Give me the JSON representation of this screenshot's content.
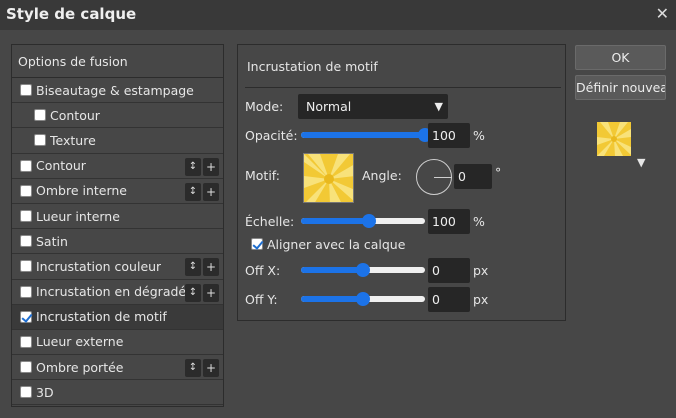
{
  "window": {
    "title": "Style de calque",
    "close_glyph": "✕"
  },
  "left_panel": {
    "header": "Options de fusion",
    "items": [
      {
        "label": "Biseautage & estampage",
        "checked": false,
        "sub": false,
        "buttons": false
      },
      {
        "label": "Contour",
        "checked": false,
        "sub": true,
        "buttons": false
      },
      {
        "label": "Texture",
        "checked": false,
        "sub": true,
        "buttons": false
      },
      {
        "label": "Contour",
        "checked": false,
        "sub": false,
        "buttons": true
      },
      {
        "label": "Ombre interne",
        "checked": false,
        "sub": false,
        "buttons": true
      },
      {
        "label": "Lueur interne",
        "checked": false,
        "sub": false,
        "buttons": false
      },
      {
        "label": "Satin",
        "checked": false,
        "sub": false,
        "buttons": false
      },
      {
        "label": "Incrustation couleur",
        "checked": false,
        "sub": false,
        "buttons": true
      },
      {
        "label": "Incrustation en dégradé",
        "checked": false,
        "sub": false,
        "buttons": true
      },
      {
        "label": "Incrustation de motif",
        "checked": true,
        "sub": false,
        "buttons": false,
        "selected": true
      },
      {
        "label": "Lueur externe",
        "checked": false,
        "sub": false,
        "buttons": false
      },
      {
        "label": "Ombre portée",
        "checked": false,
        "sub": false,
        "buttons": true
      },
      {
        "label": "3D",
        "checked": false,
        "sub": false,
        "buttons": false
      }
    ],
    "reorder_glyph": "↕",
    "add_glyph": "+"
  },
  "pattern_panel": {
    "title": "Incrustation de motif",
    "mode_label": "Mode:",
    "mode_value": "Normal",
    "opacity_label": "Opacité:",
    "opacity_value": "100",
    "opacity_unit": "%",
    "opacity_level": 1.0,
    "pattern_label": "Motif:",
    "angle_label": "Angle:",
    "angle_value": "0",
    "angle_unit": "°",
    "scale_label": "Échelle:",
    "scale_value": "100",
    "scale_unit": "%",
    "scale_level": 0.55,
    "align_label": "Aligner avec la calque",
    "align_checked": true,
    "offx_label": "Off X:",
    "offx_value": "0",
    "offx_unit": "px",
    "offx_level": 0.5,
    "offy_label": "Off Y:",
    "offy_value": "0",
    "offy_unit": "px",
    "offy_level": 0.5
  },
  "actions": {
    "ok_label": "OK",
    "define_label": "Définir nouveau"
  },
  "colors": {
    "accent": "#1c73e8",
    "pattern_base": "#f2c935",
    "pattern_light": "#f8e27a"
  }
}
